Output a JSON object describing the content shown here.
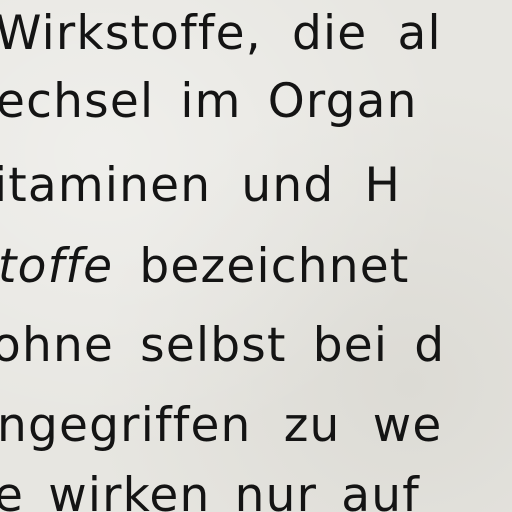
{
  "document": {
    "lines": [
      {
        "text": "Wirkstoffe, die al"
      },
      {
        "text": "echsel im Organ"
      },
      {
        "text": "itaminen und H"
      },
      {
        "italic": "toffe",
        "text": " bezeichnet"
      },
      {
        "text": "ohne selbst bei d"
      },
      {
        "text": "ngegriffen zu we"
      },
      {
        "text": "e wirken nur auf"
      }
    ]
  }
}
